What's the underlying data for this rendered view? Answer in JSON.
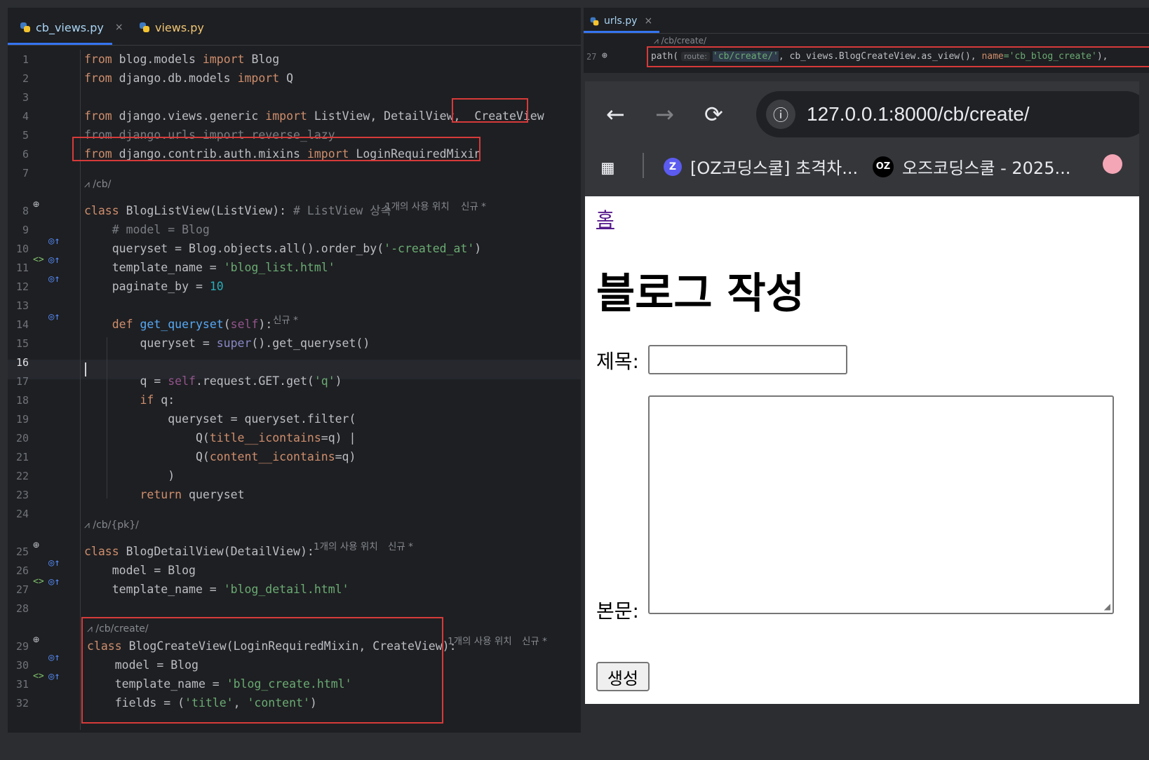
{
  "left_editor": {
    "tabs": [
      {
        "label": "cb_views.py",
        "active": true
      },
      {
        "label": "views.py",
        "active": false
      }
    ],
    "close_glyph": "×",
    "lines": [
      {
        "n": "1",
        "tokens": [
          {
            "t": "from ",
            "c": "kw"
          },
          {
            "t": "blog.models "
          },
          {
            "t": "import ",
            "c": "kw"
          },
          {
            "t": "Blog"
          }
        ]
      },
      {
        "n": "2",
        "tokens": [
          {
            "t": "from ",
            "c": "kw"
          },
          {
            "t": "django.db.models "
          },
          {
            "t": "import ",
            "c": "kw"
          },
          {
            "t": "Q"
          }
        ]
      },
      {
        "n": "3",
        "tokens": []
      },
      {
        "n": "4",
        "tokens": [
          {
            "t": "from ",
            "c": "kw"
          },
          {
            "t": "django.views.generic "
          },
          {
            "t": "import ",
            "c": "kw"
          },
          {
            "t": "ListView, DetailView,  CreateView"
          }
        ]
      },
      {
        "n": "5",
        "tokens": [
          {
            "t": "from django.urls import reverse_lazy",
            "c": "cm"
          }
        ]
      },
      {
        "n": "6",
        "tokens": [
          {
            "t": "from ",
            "c": "kw"
          },
          {
            "t": "django.contrib.auth.mixins "
          },
          {
            "t": "import ",
            "c": "kw"
          },
          {
            "t": "LoginRequiredMixin"
          }
        ]
      },
      {
        "n": "7",
        "tokens": []
      },
      {
        "n": "8",
        "tokens": [
          {
            "t": "class ",
            "c": "kw"
          },
          {
            "t": "BlogListView(ListView): "
          },
          {
            "t": "# ListView 상속",
            "c": "cm"
          }
        ]
      },
      {
        "n": "9",
        "tokens": [
          {
            "t": "    "
          },
          {
            "t": "# model = Blog",
            "c": "cm"
          }
        ]
      },
      {
        "n": "10",
        "tokens": [
          {
            "t": "    queryset = Blog.objects.all().order_by("
          },
          {
            "t": "'-created_at'",
            "c": "str"
          },
          {
            "t": ")"
          }
        ]
      },
      {
        "n": "11",
        "tokens": [
          {
            "t": "    template_name = "
          },
          {
            "t": "'blog_list.html'",
            "c": "str"
          }
        ]
      },
      {
        "n": "12",
        "tokens": [
          {
            "t": "    paginate_by = "
          },
          {
            "t": "10",
            "c": "num"
          }
        ]
      },
      {
        "n": "13",
        "tokens": []
      },
      {
        "n": "14",
        "tokens": [
          {
            "t": "    "
          },
          {
            "t": "def ",
            "c": "kw"
          },
          {
            "t": "get_queryset",
            "c": "fn"
          },
          {
            "t": "("
          },
          {
            "t": "self",
            "c": "self"
          },
          {
            "t": "):"
          }
        ]
      },
      {
        "n": "15",
        "tokens": [
          {
            "t": "        queryset = "
          },
          {
            "t": "super",
            "c": "builtin"
          },
          {
            "t": "().get_queryset()"
          }
        ]
      },
      {
        "n": "16",
        "tokens": []
      },
      {
        "n": "17",
        "tokens": [
          {
            "t": "        q = "
          },
          {
            "t": "self",
            "c": "self"
          },
          {
            "t": ".request.GET.get("
          },
          {
            "t": "'q'",
            "c": "str"
          },
          {
            "t": ")"
          }
        ]
      },
      {
        "n": "18",
        "tokens": [
          {
            "t": "        "
          },
          {
            "t": "if ",
            "c": "kw"
          },
          {
            "t": "q:"
          }
        ]
      },
      {
        "n": "19",
        "tokens": [
          {
            "t": "            queryset = queryset.filter("
          }
        ]
      },
      {
        "n": "20",
        "tokens": [
          {
            "t": "                Q("
          },
          {
            "t": "title__icontains",
            "c": "param"
          },
          {
            "t": "=q) |"
          }
        ]
      },
      {
        "n": "21",
        "tokens": [
          {
            "t": "                Q("
          },
          {
            "t": "content__icontains",
            "c": "param"
          },
          {
            "t": "=q)"
          }
        ]
      },
      {
        "n": "22",
        "tokens": [
          {
            "t": "            )"
          }
        ]
      },
      {
        "n": "23",
        "tokens": [
          {
            "t": "        "
          },
          {
            "t": "return ",
            "c": "kw"
          },
          {
            "t": "queryset"
          }
        ]
      },
      {
        "n": "24",
        "tokens": []
      },
      {
        "n": "25",
        "tokens": [
          {
            "t": "class ",
            "c": "kw"
          },
          {
            "t": "BlogDetailView(DetailView):"
          }
        ]
      },
      {
        "n": "26",
        "tokens": [
          {
            "t": "    model = Blog"
          }
        ]
      },
      {
        "n": "27",
        "tokens": [
          {
            "t": "    template_name = "
          },
          {
            "t": "'blog_detail.html'",
            "c": "str"
          }
        ]
      },
      {
        "n": "28",
        "tokens": []
      },
      {
        "n": "29",
        "tokens": [
          {
            "t": "class ",
            "c": "kw"
          },
          {
            "t": "BlogCreateView(LoginRequiredMixin, CreateView):"
          }
        ]
      },
      {
        "n": "30",
        "tokens": [
          {
            "t": "    model = Blog"
          }
        ]
      },
      {
        "n": "31",
        "tokens": [
          {
            "t": "    template_name = "
          },
          {
            "t": "'blog_create.html'",
            "c": "str"
          }
        ]
      },
      {
        "n": "32",
        "tokens": [
          {
            "t": "    fields = ("
          },
          {
            "t": "'title'",
            "c": "str"
          },
          {
            "t": ", "
          },
          {
            "t": "'content'",
            "c": "str"
          },
          {
            "t": ")"
          }
        ]
      }
    ],
    "route_hints": {
      "list": "/cb/",
      "detail": "/cb/{pk}/",
      "create": "/cb/create/"
    },
    "inlay_hints": {
      "usage_list": "1개의 사용 위치",
      "new_list": "신규 *",
      "new_get_queryset": "신규 *",
      "usage_detail": "1개의 사용 위치",
      "new_detail": "신규 *",
      "usage_create": "1개의 사용 위치",
      "new_create": "신규 *"
    }
  },
  "right_editor": {
    "tab_label": "urls.py",
    "close_glyph": "×",
    "route_hint": "/cb/create/",
    "line_number": "27",
    "code": {
      "prefix": "path(",
      "route_param": "route:",
      "route_str": "'cb/create/'",
      "middle": ", cb_views.BlogCreateView.as_view(), ",
      "name_kw": "name",
      "name_val": "='cb_blog_create'",
      "suffix": "),"
    }
  },
  "browser": {
    "url": "127.0.0.1:8000/cb/create/",
    "bookmarks": [
      {
        "label": "[OZ코딩스쿨] 초격차...",
        "icon": "Z"
      },
      {
        "label": "오즈코딩스쿨 - 2025...",
        "icon": "OZ"
      }
    ],
    "page": {
      "home_link": "홈",
      "heading": "블로그 작성",
      "title_label": "제목:",
      "content_label": "본문:",
      "submit_label": "생성"
    }
  }
}
